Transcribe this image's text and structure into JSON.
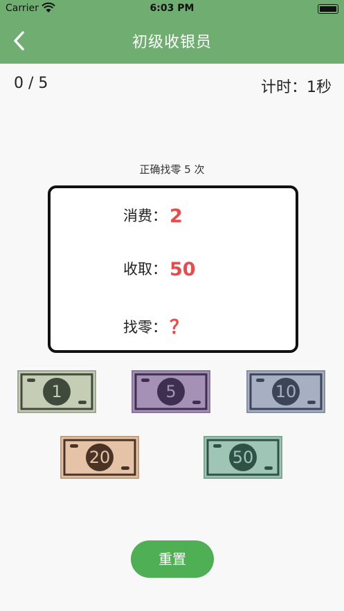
{
  "status": {
    "carrier": "Carrier",
    "time": "6:03 PM"
  },
  "nav": {
    "title": "初级收银员"
  },
  "progress": {
    "score": "0 / 5",
    "timer": "计时：1秒"
  },
  "hint": "正确找零 5 次",
  "card": {
    "spend_label": "消费：",
    "spend_value": "2",
    "received_label": "收取：",
    "received_value": "50",
    "change_label": "找零：",
    "change_value": "？"
  },
  "bills": [
    {
      "label": "1",
      "bg": "#c6cdb5",
      "frame": "#8e9a84",
      "dark": "#3f4a3c"
    },
    {
      "label": "5",
      "bg": "#a591b6",
      "frame": "#7e6a92",
      "dark": "#3e2f50"
    },
    {
      "label": "10",
      "bg": "#a7afc2",
      "frame": "#7b8598",
      "dark": "#3b4555"
    },
    {
      "label": "20",
      "bg": "#e4c3a7",
      "frame": "#b89071",
      "dark": "#4a3325"
    },
    {
      "label": "50",
      "bg": "#9ec5b5",
      "frame": "#6f9b8a",
      "dark": "#2f5246"
    }
  ],
  "buttons": {
    "reset": "重置"
  },
  "colors": {
    "nav": "#6fae70",
    "accent": "#e94a4a",
    "reset": "#4eaf55"
  }
}
